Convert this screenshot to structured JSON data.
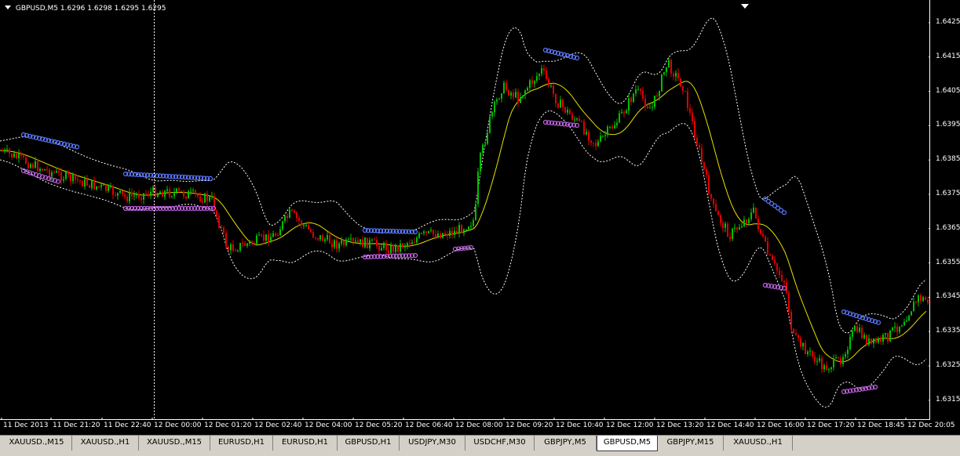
{
  "chart": {
    "title": "GBPUSD,M5",
    "ohlc": "1.6296 1.6298 1.6295 1.6295",
    "colors": {
      "background": "#000000",
      "bull": "#00c000",
      "bear": "#e00000",
      "ma": "#e8e000",
      "bands": "#ffffff",
      "upper_dots": "#5a78ff",
      "lower_dots": "#c060e0"
    },
    "price_axis": [
      "1.6425",
      "1.6415",
      "1.6405",
      "1.6395",
      "1.6385",
      "1.6375",
      "1.6365",
      "1.6355",
      "1.6345",
      "1.6335",
      "1.6325",
      "1.6315"
    ],
    "time_axis": [
      "11 Dec 2013",
      "11 Dec 21:20",
      "11 Dec 22:40",
      "12 Dec 00:00",
      "12 Dec 01:20",
      "12 Dec 02:40",
      "12 Dec 04:00",
      "12 Dec 05:20",
      "12 Dec 06:40",
      "12 Dec 08:00",
      "12 Dec 09:20",
      "12 Dec 10:40",
      "12 Dec 12:00",
      "12 Dec 13:20",
      "12 Dec 14:40",
      "12 Dec 16:00",
      "12 Dec 17:20",
      "12 Dec 18:45",
      "12 Dec 20:05"
    ]
  },
  "tabs": [
    {
      "label": "XAUUSD.,M15",
      "active": false
    },
    {
      "label": "XAUUSD.,H1",
      "active": false
    },
    {
      "label": "XAUUSD.,M15",
      "active": false
    },
    {
      "label": "EURUSD,H1",
      "active": false
    },
    {
      "label": "EURUSD,H1",
      "active": false
    },
    {
      "label": "GBPUSD,H1",
      "active": false
    },
    {
      "label": "USDJPY,M30",
      "active": false
    },
    {
      "label": "USDCHF,M30",
      "active": false
    },
    {
      "label": "GBPJPY,M5",
      "active": false
    },
    {
      "label": "GBPUSD,M5",
      "active": true
    },
    {
      "label": "GBPJPY,M15",
      "active": false
    },
    {
      "label": "XAUUSD.,H1",
      "active": false
    }
  ]
}
